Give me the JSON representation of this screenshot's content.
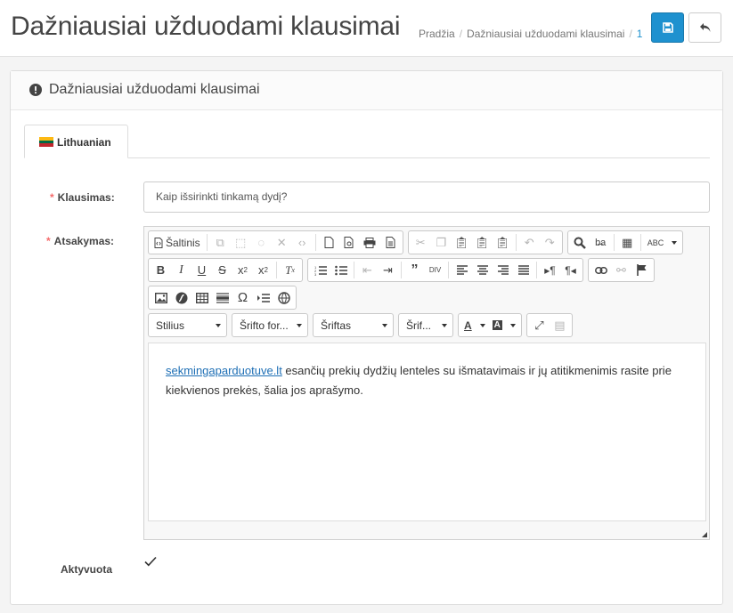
{
  "header": {
    "title": "Dažniausiai užduodami klausimai",
    "breadcrumb": [
      "Pradžia",
      "Dažniausiai užduodami klausimai",
      "1"
    ],
    "save_icon": "save-icon",
    "back_icon": "reply-icon"
  },
  "panel": {
    "title": "Dažniausiai užduodami klausimai",
    "icon": "exclamation-circle-icon"
  },
  "tabs": [
    {
      "label": "Lithuanian",
      "flag": "lithuania-flag"
    }
  ],
  "form": {
    "question_label": "Klausimas:",
    "question_value": "Kaip išsirinkti tinkamą dydį?",
    "answer_label": "Atsakymas:",
    "active_label": "Aktyvuota",
    "active_checked": true
  },
  "editor": {
    "source_label": "Šaltinis",
    "styles_label": "Stilius",
    "format_label": "Šrifto for...",
    "font_label": "Šriftas",
    "size_label": "Šrif...",
    "content_link": "sekmingaparduotuve.lt",
    "content_text": " esančių prekių dydžių lenteles su išmatavimais ir jų atitikmenimis rasite prie kiekvienos prekės, šalia jos aprašymo."
  },
  "colors": {
    "primary": "#1e91cf",
    "required": "#f56b6b",
    "link": "#1e6fb5"
  }
}
